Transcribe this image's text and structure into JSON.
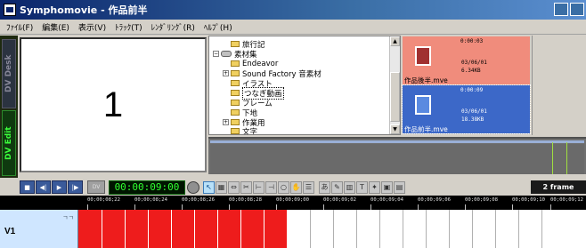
{
  "window": {
    "title": "Symphomovie - 作品前半"
  },
  "menu": [
    "ﾌｧｲﾙ(F)",
    "編集(E)",
    "表示(V)",
    "ﾄﾗｯｸ(T)",
    "ﾚﾝﾀﾞﾘﾝｸﾞ(R)",
    "ﾍﾙﾌﾟ(H)"
  ],
  "side_tabs": {
    "dv_desk": "DV Desk",
    "dv_edit": "DV Edit"
  },
  "preview": {
    "frame_number": "1"
  },
  "folder_tree": {
    "items": [
      {
        "label": "旅行記",
        "kind": "folder",
        "level": 2
      },
      {
        "label": "素材集",
        "kind": "drive",
        "level": 0
      },
      {
        "label": "Endeavor",
        "kind": "folder",
        "level": 2
      },
      {
        "label": "Sound Factory 音素材",
        "kind": "folder",
        "level": 1,
        "expandable": true
      },
      {
        "label": "イラスト",
        "kind": "folder",
        "level": 2
      },
      {
        "label": "つなぎ動画",
        "kind": "folder",
        "level": 2,
        "selected": true
      },
      {
        "label": "フレーム",
        "kind": "folder",
        "level": 2
      },
      {
        "label": "下地",
        "kind": "folder",
        "level": 2
      },
      {
        "label": "作業用",
        "kind": "folder",
        "level": 1,
        "expandable": true
      },
      {
        "label": "文字",
        "kind": "folder",
        "level": 2
      }
    ]
  },
  "clips": [
    {
      "timecode": "0:00:03",
      "date": "03/06/01",
      "size": "6.34KB",
      "name": "作品後半.mve",
      "bg": "#f08c7c",
      "selected": false
    },
    {
      "timecode": "0:00:09",
      "date": "03/06/01",
      "size": "18.38KB",
      "name": "作品前半.mve",
      "bg": "#3c68c8",
      "selected": true
    }
  ],
  "transport": {
    "timecode": "00:00:09:00",
    "dv_label": "DV",
    "frame_mode": "2 frame",
    "buttons": [
      "stop",
      "prev",
      "play",
      "next"
    ]
  },
  "tools": [
    "arrow-icon",
    "select-range-icon",
    "link-icon",
    "razor-icon",
    "in-point-icon",
    "out-point-icon",
    "zoom-icon",
    "hand-icon",
    "list-icon",
    "text-icon",
    "paint-icon",
    "layout-icon",
    "title-icon",
    "effect-icon",
    "render-icon",
    "film-icon"
  ],
  "ruler": {
    "ticks": [
      "00;00;08;22",
      "00;00;08;24",
      "00;00;08;26",
      "00;00;08;28",
      "00;00;09;00",
      "00;00;09;02",
      "00;00;09;04",
      "00;00;09;06",
      "00;00;09;08",
      "00;00;09;10",
      "00;00;09;12"
    ]
  },
  "track": {
    "name": "V1",
    "flag": "ㄱㄱ"
  },
  "colors": {
    "clip_red": "#ee1c1c",
    "timecode_green": "#30ff30",
    "track_header": "#cfe6ff"
  }
}
